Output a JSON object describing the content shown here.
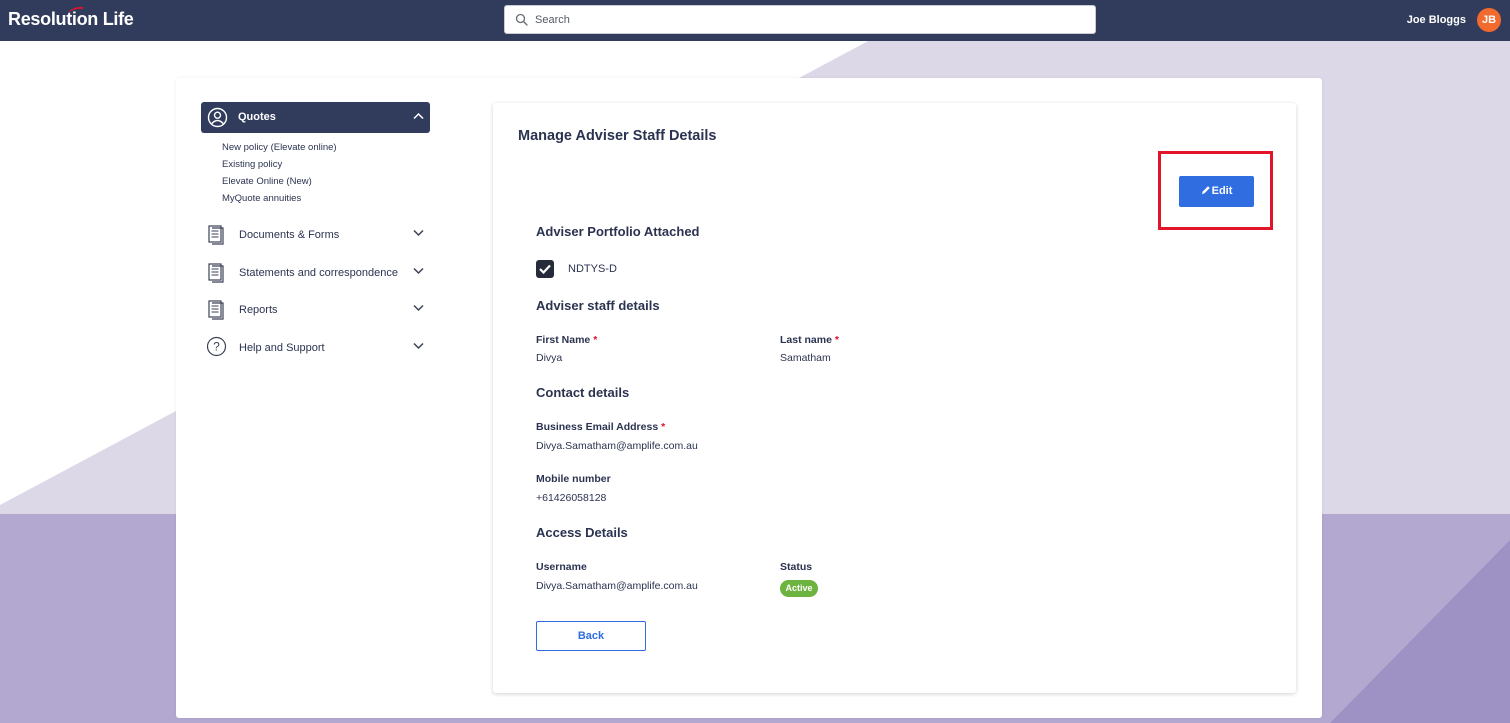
{
  "header": {
    "logo_text": "Resolution Life",
    "search_placeholder": "Search",
    "user_name": "Joe Bloggs",
    "user_initials": "JB"
  },
  "sidebar": {
    "active": {
      "label": "Quotes",
      "icon": "user-circle-icon",
      "sub_items": [
        "New policy (Elevate online)",
        "Existing policy",
        "Elevate Online (New)",
        "MyQuote annuities"
      ]
    },
    "items": [
      {
        "label": "Documents & Forms",
        "icon": "document-icon"
      },
      {
        "label": "Statements and correspondence",
        "icon": "document-icon"
      },
      {
        "label": "Reports",
        "icon": "document-icon"
      },
      {
        "label": "Help and Support",
        "icon": "help-circle-icon"
      }
    ]
  },
  "main": {
    "title": "Manage Adviser Staff Details",
    "edit_label": "Edit",
    "portfolio": {
      "heading": "Adviser Portfolio Attached",
      "checkbox_label": "NDTYS-D",
      "checked": true
    },
    "staff": {
      "heading": "Adviser staff details",
      "first_name_label": "First Name",
      "first_name_value": "Divya",
      "last_name_label": "Last name",
      "last_name_value": "Samatham"
    },
    "contact": {
      "heading": "Contact details",
      "email_label": "Business Email Address",
      "email_value": "Divya.Samatham@amplife.com.au",
      "mobile_label": "Mobile number",
      "mobile_value": "+61426058128"
    },
    "access": {
      "heading": "Access Details",
      "username_label": "Username",
      "username_value": "Divya.Samatham@amplife.com.au",
      "status_label": "Status",
      "status_value": "Active"
    },
    "back_label": "Back",
    "required_marker": "*"
  },
  "colors": {
    "header_bg": "#313c5c",
    "primary_button": "#2f6de0",
    "highlight_border": "#e3132a",
    "status_active": "#6db33f",
    "avatar_bg": "#f26a2e",
    "bg_lavender_light": "#dcd8e8",
    "bg_lavender_dark": "#b3a9d0"
  }
}
